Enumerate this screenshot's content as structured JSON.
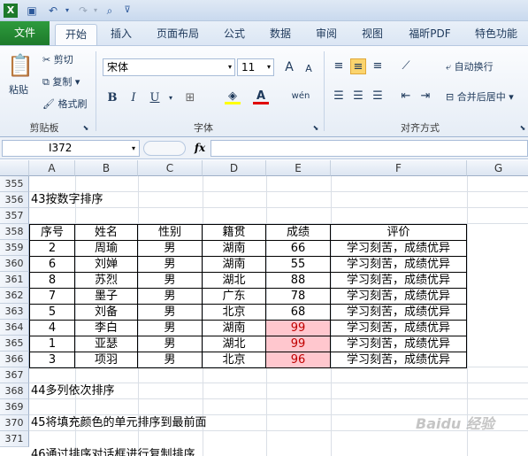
{
  "window": {
    "title_icons": [
      "save-icon",
      "undo-icon",
      "redo-icon",
      "print-preview-icon",
      "customize-qat-icon"
    ]
  },
  "tabs": [
    "文件",
    "开始",
    "插入",
    "页面布局",
    "公式",
    "数据",
    "审阅",
    "视图",
    "福昕PDF",
    "特色功能"
  ],
  "ribbon": {
    "clipboard": {
      "paste": "粘贴",
      "cut": "剪切",
      "copy": "复制",
      "format_painter": "格式刷",
      "label": "剪贴板"
    },
    "font": {
      "name": "宋体",
      "size": "11",
      "grow": "A",
      "shrink": "A",
      "bold": "B",
      "italic": "I",
      "underline": "U",
      "wen": "wén",
      "label": "字体"
    },
    "alignment": {
      "wrap": "自动换行",
      "merge": "合并后居中",
      "label": "对齐方式"
    }
  },
  "formula_bar": {
    "name_box": "I372",
    "fx": "fx",
    "formula": ""
  },
  "columns": [
    "A",
    "B",
    "C",
    "D",
    "E",
    "F",
    "G"
  ],
  "rows": [
    "355",
    "356",
    "357",
    "358",
    "359",
    "360",
    "361",
    "362",
    "363",
    "364",
    "365",
    "366",
    "367",
    "368",
    "369",
    "370",
    "371"
  ],
  "sheet": {
    "heading_356": "43按数字排序",
    "table_headers": [
      "序号",
      "姓名",
      "性别",
      "籍贯",
      "成绩",
      "评价"
    ],
    "table_rows": [
      [
        "2",
        "周瑜",
        "男",
        "湖南",
        "66",
        "学习刻苦，成绩优异"
      ],
      [
        "6",
        "刘婵",
        "男",
        "湖南",
        "55",
        "学习刻苦，成绩优异"
      ],
      [
        "8",
        "苏烈",
        "男",
        "湖北",
        "88",
        "学习刻苦，成绩优异"
      ],
      [
        "7",
        "墨子",
        "男",
        "广东",
        "78",
        "学习刻苦，成绩优异"
      ],
      [
        "5",
        "刘备",
        "男",
        "北京",
        "68",
        "学习刻苦，成绩优异"
      ],
      [
        "4",
        "李白",
        "男",
        "湖南",
        "99",
        "学习刻苦，成绩优异"
      ],
      [
        "1",
        "亚瑟",
        "男",
        "湖北",
        "99",
        "学习刻苦，成绩优异"
      ],
      [
        "3",
        "项羽",
        "男",
        "北京",
        "96",
        "学习刻苦，成绩优异"
      ]
    ],
    "highlighted_rows": [
      5,
      6,
      7
    ],
    "highlight_color": "#ffc7ce",
    "heading_368": "44多列依次排序",
    "heading_370": "45将填充颜色的单元排序到最前面",
    "heading_372": "46通过排序对话框进行复制排序"
  },
  "watermark": "Baidu 经验"
}
